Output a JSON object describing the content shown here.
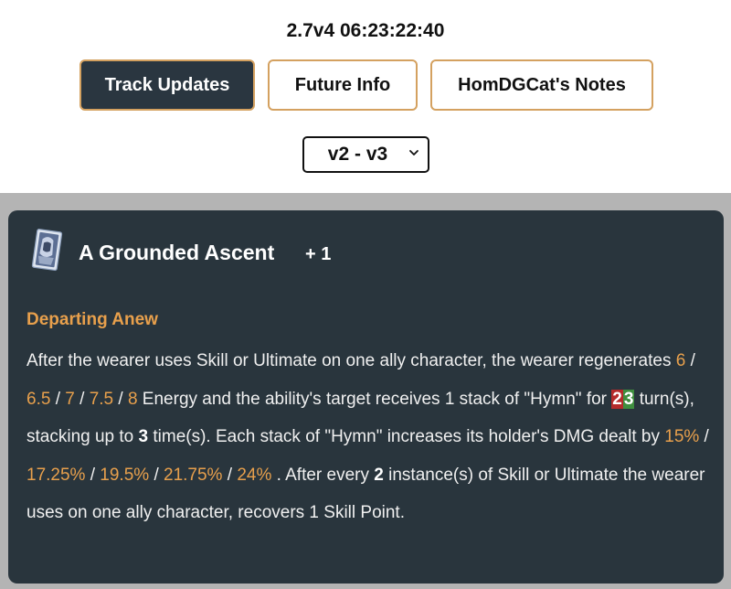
{
  "header": {
    "version_time": "2.7v4 06:23:22:40"
  },
  "tabs": [
    {
      "label": "Track Updates",
      "active": true
    },
    {
      "label": "Future Info",
      "active": false
    },
    {
      "label": "HomDGCat's Notes",
      "active": false
    }
  ],
  "version_select": {
    "selected": "v2 - v3"
  },
  "light_cone": {
    "name": "A Grounded Ascent",
    "rank": "+ 1",
    "effect_name": "Departing Anew",
    "description": {
      "p1": "After the wearer uses Skill or Ultimate on one ally character, the wearer regenerates ",
      "energy": [
        "6",
        "6.5",
        "7",
        "7.5",
        "8"
      ],
      "sep": " / ",
      "p2": " Energy and the ability's target receives 1 stack of \"Hymn\" for ",
      "duration_old": "2",
      "duration_new": "3",
      "p3": " turn(s), stacking up to ",
      "max_stacks": "3",
      "p4": " time(s). Each stack of \"Hymn\" increases its holder's DMG dealt by ",
      "dmg": [
        "15%",
        "17.25%",
        "19.5%",
        "21.75%",
        "24%"
      ],
      "p5": " . After every ",
      "every_count": "2",
      "p6": " instance(s) of Skill or Ultimate the wearer uses on one ally character, recovers 1 Skill Point."
    }
  },
  "colors": {
    "accent": "#e8a04c",
    "card_bg": "#29353d",
    "page_bg_lower": "#b4b4b4",
    "diff_removed": "#b52b2b",
    "diff_added": "#3f8f3f"
  },
  "icons": {
    "light_cone": "light-cone-icon",
    "select_chevron": "chevron-down-icon"
  }
}
